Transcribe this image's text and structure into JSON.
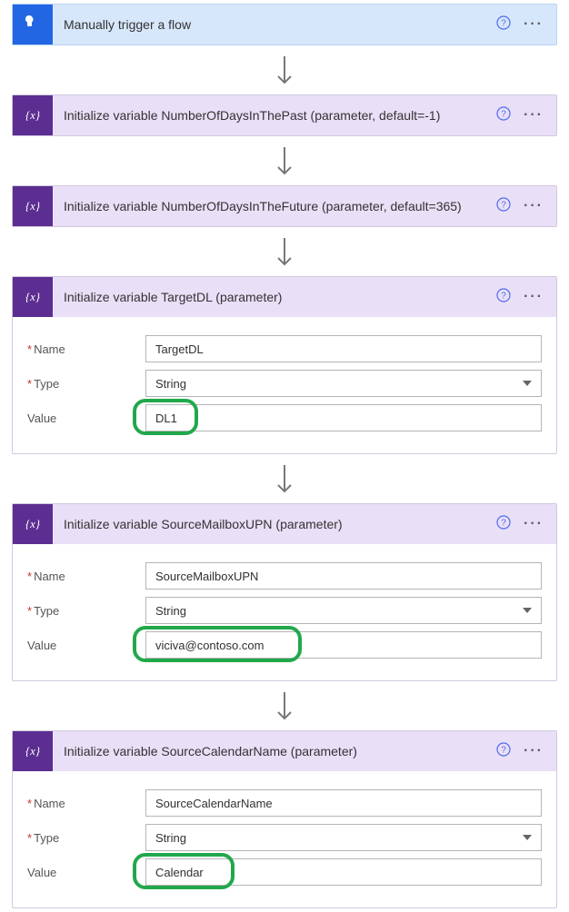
{
  "colors": {
    "trigger_icon_bg": "#2266e3",
    "var_icon_bg": "#5c2e91",
    "trigger_hdr": "#d7e7fb",
    "var_hdr": "#e9dff7",
    "highlight": "#22a84c"
  },
  "labels": {
    "name": "Name",
    "type": "Type",
    "value": "Value"
  },
  "steps": [
    {
      "kind": "trigger",
      "title": "Manually trigger a flow"
    },
    {
      "kind": "var",
      "title": "Initialize variable NumberOfDaysInThePast (parameter, default=-1)"
    },
    {
      "kind": "var",
      "title": "Initialize variable NumberOfDaysInTheFuture (parameter, default=365)"
    },
    {
      "kind": "var",
      "title": "Initialize variable TargetDL (parameter)",
      "expanded": true,
      "name": "TargetDL",
      "type": "String",
      "value": "DL1",
      "highlight": true,
      "hw": 72
    },
    {
      "kind": "var",
      "title": "Initialize variable SourceMailboxUPN (parameter)",
      "expanded": true,
      "name": "SourceMailboxUPN",
      "type": "String",
      "value": "viciva@contoso.com",
      "highlight": true,
      "hw": 186
    },
    {
      "kind": "var",
      "title": "Initialize variable SourceCalendarName (parameter)",
      "expanded": true,
      "name": "SourceCalendarName",
      "type": "String",
      "value": "Calendar",
      "highlight": true,
      "hw": 112
    }
  ]
}
